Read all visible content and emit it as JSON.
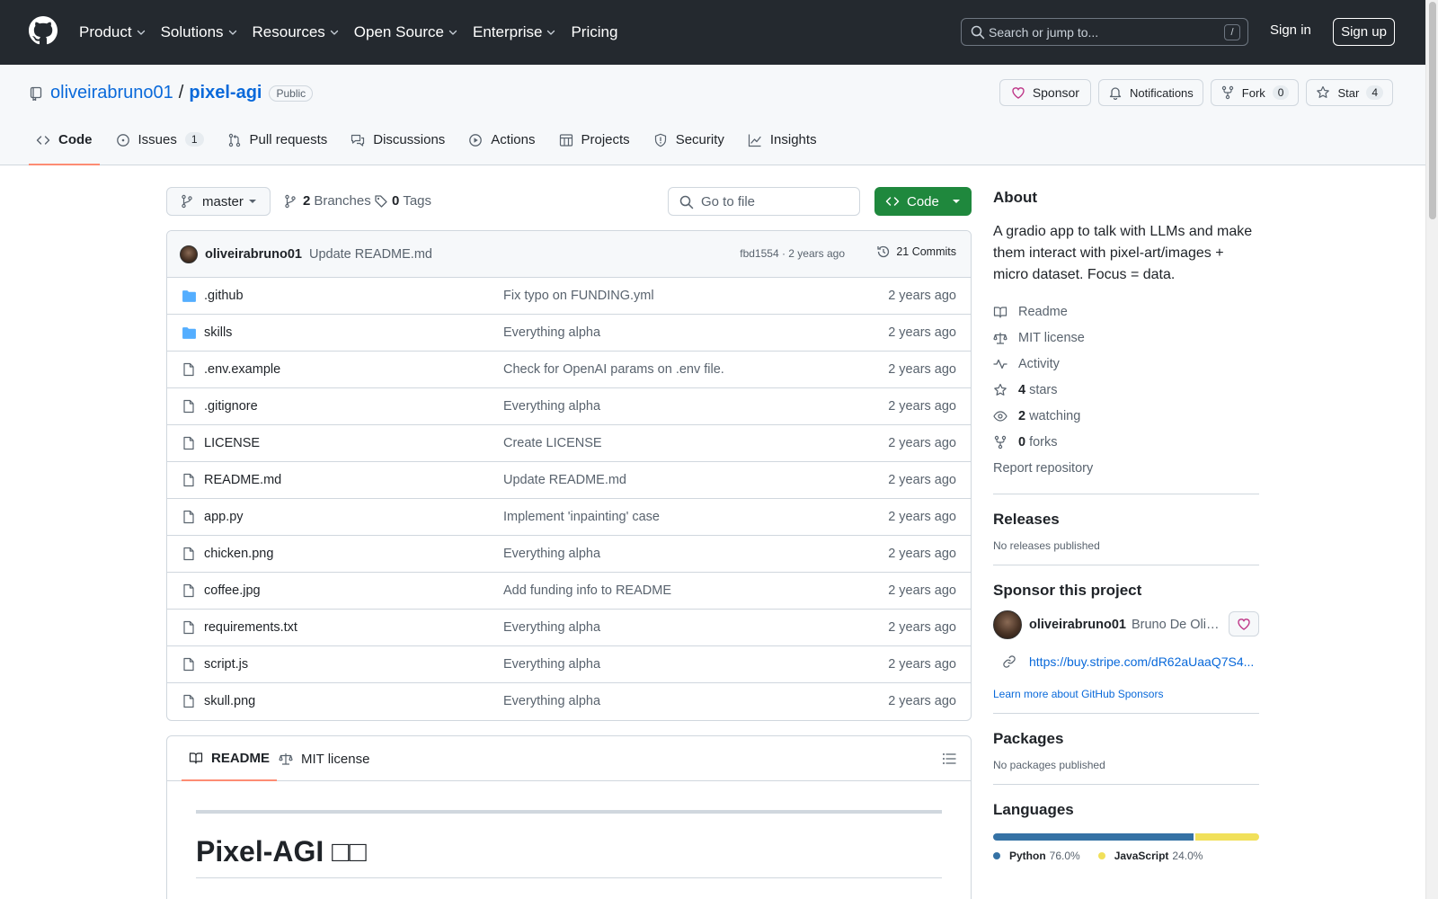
{
  "header": {
    "nav": [
      {
        "label": "Product",
        "dropdown": true
      },
      {
        "label": "Solutions",
        "dropdown": true
      },
      {
        "label": "Resources",
        "dropdown": true
      },
      {
        "label": "Open Source",
        "dropdown": true
      },
      {
        "label": "Enterprise",
        "dropdown": true
      },
      {
        "label": "Pricing",
        "dropdown": false
      }
    ],
    "search_placeholder": "Search or jump to...",
    "search_shortcut": "/",
    "sign_in": "Sign in",
    "sign_up": "Sign up"
  },
  "repo": {
    "owner": "oliveirabruno01",
    "separator": "/",
    "name": "pixel-agi",
    "visibility": "Public",
    "sponsor_label": "Sponsor",
    "notifications_label": "Notifications",
    "fork_label": "Fork",
    "fork_count": "0",
    "star_label": "Star",
    "star_count": "4",
    "tabs": [
      {
        "label": "Code",
        "icon": "code-icon",
        "active": true,
        "count": ""
      },
      {
        "label": "Issues",
        "icon": "issue-icon",
        "active": false,
        "count": "1"
      },
      {
        "label": "Pull requests",
        "icon": "pull-request-icon",
        "active": false,
        "count": ""
      },
      {
        "label": "Discussions",
        "icon": "discussions-icon",
        "active": false,
        "count": ""
      },
      {
        "label": "Actions",
        "icon": "play-icon",
        "active": false,
        "count": ""
      },
      {
        "label": "Projects",
        "icon": "table-icon",
        "active": false,
        "count": ""
      },
      {
        "label": "Security",
        "icon": "shield-icon",
        "active": false,
        "count": ""
      },
      {
        "label": "Insights",
        "icon": "graph-icon",
        "active": false,
        "count": ""
      }
    ]
  },
  "toolbar": {
    "branch": "master",
    "branches_count": "2",
    "branches_label": "Branches",
    "tags_count": "0",
    "tags_label": "Tags",
    "go_to_file": "Go to file",
    "code_label": "Code"
  },
  "latest_commit": {
    "author": "oliveirabruno01",
    "message": "Update README.md",
    "meta": "fbd1554 · 2 years ago",
    "commits_label": "21 Commits"
  },
  "files": [
    {
      "name": ".github",
      "type": "folder",
      "message": "Fix typo on FUNDING.yml",
      "date": "2 years ago"
    },
    {
      "name": "skills",
      "type": "folder",
      "message": "Everything alpha",
      "date": "2 years ago"
    },
    {
      "name": ".env.example",
      "type": "file",
      "message": "Check for OpenAI params on .env file.",
      "date": "2 years ago"
    },
    {
      "name": ".gitignore",
      "type": "file",
      "message": "Everything alpha",
      "date": "2 years ago"
    },
    {
      "name": "LICENSE",
      "type": "file",
      "message": "Create LICENSE",
      "date": "2 years ago"
    },
    {
      "name": "README.md",
      "type": "file",
      "message": "Update README.md",
      "date": "2 years ago"
    },
    {
      "name": "app.py",
      "type": "file",
      "message": "Implement 'inpainting' case",
      "date": "2 years ago"
    },
    {
      "name": "chicken.png",
      "type": "file",
      "message": "Everything alpha",
      "date": "2 years ago"
    },
    {
      "name": "coffee.jpg",
      "type": "file",
      "message": "Add funding info to README",
      "date": "2 years ago"
    },
    {
      "name": "requirements.txt",
      "type": "file",
      "message": "Everything alpha",
      "date": "2 years ago"
    },
    {
      "name": "script.js",
      "type": "file",
      "message": "Everything alpha",
      "date": "2 years ago"
    },
    {
      "name": "skull.png",
      "type": "file",
      "message": "Everything alpha",
      "date": "2 years ago"
    }
  ],
  "readme": {
    "tab_readme": "README",
    "tab_license": "MIT license",
    "heading": "Pixel-AGI □□"
  },
  "about": {
    "title": "About",
    "description": "A gradio app to talk with LLMs and make them interact with pixel-art/images + micro dataset. Focus = data.",
    "links": [
      {
        "icon": "book-icon",
        "bold": "",
        "label": "Readme"
      },
      {
        "icon": "law-icon",
        "bold": "",
        "label": "MIT license"
      },
      {
        "icon": "pulse-icon",
        "bold": "",
        "label": "Activity"
      },
      {
        "icon": "star-icon",
        "bold": "4",
        "label": "stars"
      },
      {
        "icon": "eye-icon",
        "bold": "2",
        "label": "watching"
      },
      {
        "icon": "fork-icon",
        "bold": "0",
        "label": "forks"
      }
    ],
    "report": "Report repository"
  },
  "releases": {
    "title": "Releases",
    "empty": "No releases published"
  },
  "sponsor": {
    "title": "Sponsor this project",
    "user": "oliveirabruno01",
    "full_name": "Bruno De Oliveira",
    "link": "https://buy.stripe.com/dR62aUaaQ7S4...",
    "learn_more": "Learn more about GitHub Sponsors"
  },
  "packages": {
    "title": "Packages",
    "empty": "No packages published"
  },
  "languages": {
    "title": "Languages",
    "items": [
      {
        "name": "Python",
        "percent": "76.0%",
        "value": 76.0,
        "color": "#3572A5"
      },
      {
        "name": "JavaScript",
        "percent": "24.0%",
        "value": 24.0,
        "color": "#f1e05a"
      }
    ]
  },
  "colors": {
    "header_bg": "#24292f",
    "link": "#0969da",
    "primary_button": "#1f883d",
    "tab_underline": "#fd8c73",
    "folder": "#54aeff",
    "heart": "#bf3989"
  }
}
